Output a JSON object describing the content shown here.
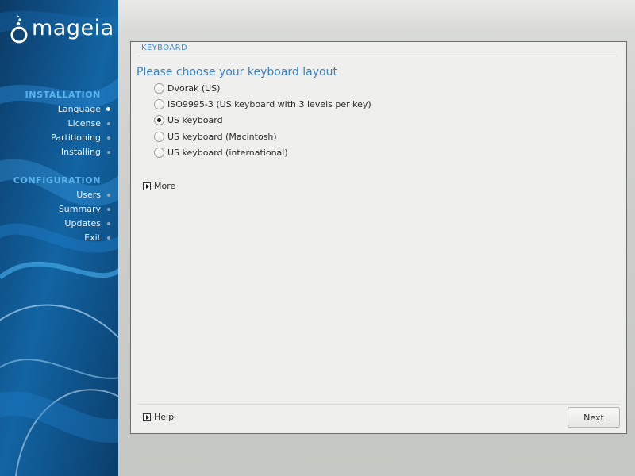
{
  "sidebar": {
    "logo_text": "mageia",
    "sections": [
      {
        "heading": "INSTALLATION",
        "items": [
          {
            "label": "Language",
            "active": true
          },
          {
            "label": "License",
            "active": false
          },
          {
            "label": "Partitioning",
            "active": false
          },
          {
            "label": "Installing",
            "active": false
          }
        ]
      },
      {
        "heading": "CONFIGURATION",
        "items": [
          {
            "label": "Users",
            "active": false
          },
          {
            "label": "Summary",
            "active": false
          },
          {
            "label": "Updates",
            "active": false
          },
          {
            "label": "Exit",
            "active": false
          }
        ]
      }
    ]
  },
  "panel": {
    "header": "KEYBOARD",
    "title": "Please choose your keyboard layout",
    "options": [
      {
        "label": "Dvorak (US)",
        "checked": false
      },
      {
        "label": "ISO9995-3 (US keyboard with 3 levels per key)",
        "checked": false
      },
      {
        "label": "US keyboard",
        "checked": true
      },
      {
        "label": "US keyboard (Macintosh)",
        "checked": false
      },
      {
        "label": "US keyboard (international)",
        "checked": false
      }
    ],
    "more_label": "More",
    "help_label": "Help",
    "next_label": "Next"
  },
  "colors": {
    "sidebar_bg": "#0e3f6d",
    "accent_heading": "#5bb3ea",
    "title_blue": "#3b83cf",
    "panel_bg": "#eff0ee"
  },
  "icons": {
    "logo": "mageia-logo-icon",
    "expander": "triangle-right-icon",
    "nav_bullet": "dot-icon"
  }
}
